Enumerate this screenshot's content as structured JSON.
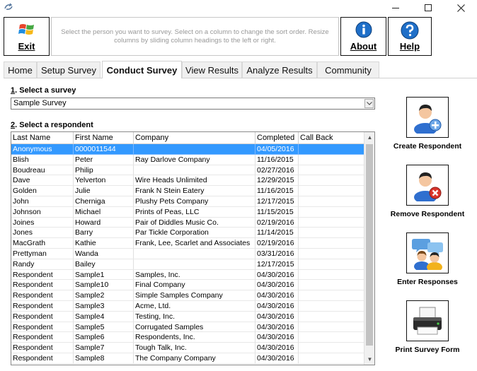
{
  "toolbar": {
    "exit_label": "Exit",
    "hint": "Select the person you want to survey. Select on a column to change the sort order. Resize columns by sliding column headings to the left or right.",
    "about_label": "About",
    "help_label": "Help"
  },
  "tabs": [
    {
      "label": "Home",
      "active": false
    },
    {
      "label": "Setup Survey",
      "active": false
    },
    {
      "label": "Conduct Survey",
      "active": true
    },
    {
      "label": "View Results",
      "active": false
    },
    {
      "label": "Analyze Results",
      "active": false
    },
    {
      "label": "Community",
      "active": false
    }
  ],
  "survey": {
    "label_num": "1",
    "label_text": ". Select a survey",
    "selected": "Sample Survey"
  },
  "respondent": {
    "label_num": "2",
    "label_text": ". Select a respondent",
    "columns": [
      "Last Name",
      "First Name",
      "Company",
      "Completed",
      "Call Back"
    ],
    "rows": [
      [
        "Anonymous",
        "0000011544",
        "",
        "04/05/2016",
        ""
      ],
      [
        "Blish",
        "Peter",
        "Ray Darlove Company",
        "11/16/2015",
        ""
      ],
      [
        "Boudreau",
        "Philip",
        "",
        "02/27/2016",
        ""
      ],
      [
        "Dave",
        "Yelverton",
        "Wire Heads Unlimited",
        "12/29/2015",
        ""
      ],
      [
        "Golden",
        "Julie",
        "Frank N Stein Eatery",
        "11/16/2015",
        ""
      ],
      [
        "John",
        "Cherniga",
        "Plushy Pets Company",
        "12/17/2015",
        ""
      ],
      [
        "Johnson",
        "Michael",
        "Prints of Peas, LLC",
        "11/15/2015",
        ""
      ],
      [
        "Joines",
        "Howard",
        "Pair of Diddles Music Co.",
        "02/19/2016",
        ""
      ],
      [
        "Jones",
        "Barry",
        "Par Tickle Corporation",
        "11/14/2015",
        ""
      ],
      [
        "MacGrath",
        "Kathie",
        "Frank, Lee, Scarlet and Associates",
        "02/19/2016",
        ""
      ],
      [
        "Prettyman",
        "Wanda",
        "",
        "03/31/2016",
        ""
      ],
      [
        "Randy",
        "Bailey",
        "",
        "12/17/2015",
        ""
      ],
      [
        "Respondent",
        "Sample1",
        "Samples, Inc.",
        "04/30/2016",
        ""
      ],
      [
        "Respondent",
        "Sample10",
        "Final Company",
        "04/30/2016",
        ""
      ],
      [
        "Respondent",
        "Sample2",
        "Simple Samples Company",
        "04/30/2016",
        ""
      ],
      [
        "Respondent",
        "Sample3",
        "Acme, Ltd.",
        "04/30/2016",
        ""
      ],
      [
        "Respondent",
        "Sample4",
        "Testing, Inc.",
        "04/30/2016",
        ""
      ],
      [
        "Respondent",
        "Sample5",
        "Corrugated Samples",
        "04/30/2016",
        ""
      ],
      [
        "Respondent",
        "Sample6",
        "Respondents, Inc.",
        "04/30/2016",
        ""
      ],
      [
        "Respondent",
        "Sample7",
        "Tough Talk, Inc.",
        "04/30/2016",
        ""
      ],
      [
        "Respondent",
        "Sample8",
        "The Company Company",
        "04/30/2016",
        ""
      ]
    ],
    "selected_index": 0
  },
  "actions": {
    "create": "Create Respondent",
    "remove": "Remove Respondent",
    "enter": "Enter Responses",
    "print": "Print Survey Form"
  },
  "colors": {
    "selection": "#3399ff",
    "hint_text": "#999999"
  }
}
